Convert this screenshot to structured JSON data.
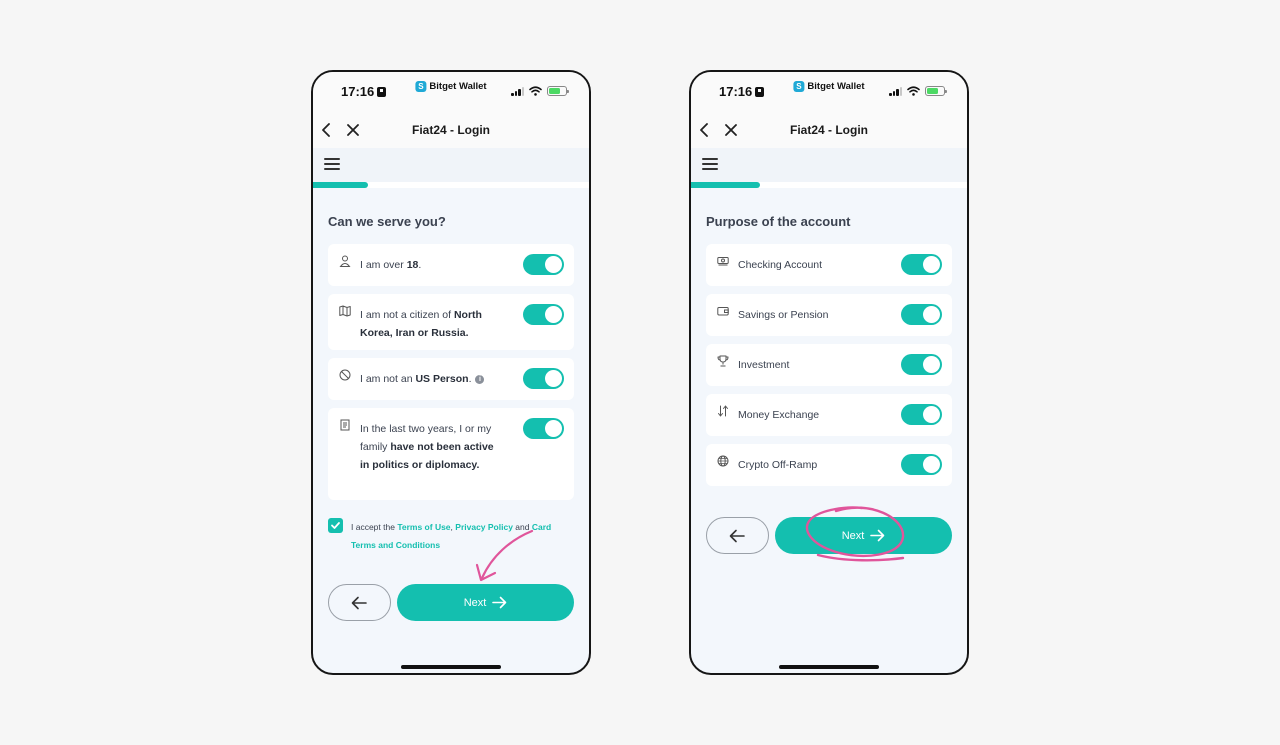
{
  "status_bar": {
    "time": "17:16",
    "brand": "Bitget Wallet"
  },
  "accent_color": "#14bfaf",
  "annotation_color": "#e0559b",
  "left_screen": {
    "nav_title": "Fiat24 - Login",
    "progress": 0.2,
    "heading": "Can we serve you?",
    "items": [
      {
        "icon": "person-icon",
        "pre": "I am over ",
        "bold": "18",
        "post": ".",
        "toggle": "on"
      },
      {
        "icon": "map-icon",
        "pre": "I am not a citizen of ",
        "bold": "North Korea, Iran or Russia.",
        "post": "",
        "toggle": "on"
      },
      {
        "icon": "ban-icon",
        "pre": "I am not an ",
        "bold": "US Person",
        "post": ".",
        "info_icon": "i",
        "toggle": "on"
      },
      {
        "icon": "document-icon",
        "pre": "In the last two years, I or my family ",
        "bold": "have not been active in politics or diplomacy.",
        "post": "",
        "toggle": "on"
      }
    ],
    "accept": {
      "pre": "I accept the ",
      "link1": "Terms of Use",
      "sep": ", ",
      "link2": "Privacy Policy",
      "and": " and ",
      "link3": "Card Terms and Conditions",
      "checked": true
    },
    "next_label": "Next"
  },
  "right_screen": {
    "nav_title": "Fiat24 - Login",
    "progress": 0.25,
    "heading": "Purpose of the account",
    "items": [
      {
        "icon": "banknote-icon",
        "label": "Checking Account",
        "toggle": "on"
      },
      {
        "icon": "wallet-icon",
        "label": "Savings or Pension",
        "toggle": "on"
      },
      {
        "icon": "trophy-icon",
        "label": "Investment",
        "toggle": "on"
      },
      {
        "icon": "exchange-arrows-icon",
        "label": "Money Exchange",
        "toggle": "on"
      },
      {
        "icon": "globe-icon",
        "label": "Crypto Off-Ramp",
        "toggle": "on"
      }
    ],
    "next_label": "Next"
  }
}
